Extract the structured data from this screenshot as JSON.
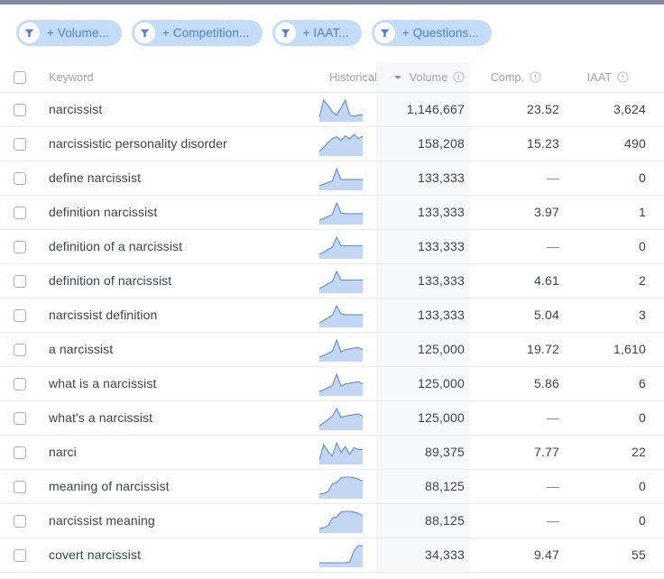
{
  "topbar": {
    "color": "#7e8a99"
  },
  "filters": {
    "chips": [
      {
        "label": "+ Volume...",
        "icon": "filter-funnel-icon"
      },
      {
        "label": "+ Competition...",
        "icon": "filter-funnel-icon"
      },
      {
        "label": "+ IAAT...",
        "icon": "filter-funnel-icon"
      },
      {
        "label": "+ Questions...",
        "icon": "filter-funnel-icon"
      }
    ]
  },
  "table": {
    "columns": {
      "keyword": "Keyword",
      "historical": "Historical",
      "volume": "Volume",
      "comp": "Comp.",
      "iaat": "IAAT"
    },
    "sorted_by": "Volume",
    "sort_direction": "desc",
    "rows": [
      {
        "keyword": "narcissist",
        "volume": "1,146,667",
        "comp": "23.52",
        "iaat": "3,624",
        "spark": [
          62,
          30,
          40,
          52,
          58,
          44,
          30,
          58,
          60,
          58,
          58
        ]
      },
      {
        "keyword": "narcissistic personality disorder",
        "volume": "158,208",
        "comp": "15.23",
        "iaat": "490",
        "spark": [
          86,
          70,
          50,
          34,
          28,
          42,
          24,
          36,
          18,
          34,
          26
        ]
      },
      {
        "keyword": "define narcissist",
        "volume": "133,333",
        "comp": "—",
        "iaat": "0",
        "spark": [
          66,
          62,
          58,
          54,
          22,
          50,
          50,
          50,
          50,
          50,
          50
        ]
      },
      {
        "keyword": "definition narcissist",
        "volume": "133,333",
        "comp": "3.97",
        "iaat": "1",
        "spark": [
          68,
          64,
          58,
          52,
          20,
          48,
          50,
          50,
          50,
          50,
          50
        ]
      },
      {
        "keyword": "definition of a narcissist",
        "volume": "133,333",
        "comp": "—",
        "iaat": "0",
        "spark": [
          70,
          64,
          56,
          50,
          22,
          46,
          46,
          46,
          46,
          46,
          46
        ]
      },
      {
        "keyword": "definition of narcissist",
        "volume": "133,333",
        "comp": "4.61",
        "iaat": "2",
        "spark": [
          70,
          64,
          56,
          50,
          22,
          46,
          46,
          46,
          46,
          46,
          46
        ]
      },
      {
        "keyword": "narcissist definition",
        "volume": "133,333",
        "comp": "5.04",
        "iaat": "3",
        "spark": [
          72,
          64,
          56,
          48,
          18,
          44,
          46,
          46,
          46,
          46,
          46
        ]
      },
      {
        "keyword": "a narcissist",
        "volume": "125,000",
        "comp": "19.72",
        "iaat": "1,610",
        "spark": [
          60,
          56,
          50,
          44,
          14,
          46,
          40,
          38,
          36,
          34,
          40
        ]
      },
      {
        "keyword": "what is a narcissist",
        "volume": "125,000",
        "comp": "5.86",
        "iaat": "6",
        "spark": [
          60,
          56,
          50,
          44,
          14,
          46,
          40,
          38,
          36,
          34,
          40
        ]
      },
      {
        "keyword": "what's a narcissist",
        "volume": "125,000",
        "comp": "—",
        "iaat": "0",
        "spark": [
          66,
          58,
          48,
          38,
          16,
          42,
          38,
          36,
          34,
          32,
          38
        ]
      },
      {
        "keyword": "narci",
        "volume": "89,375",
        "comp": "7.77",
        "iaat": "22",
        "spark": [
          62,
          30,
          44,
          54,
          26,
          46,
          34,
          50,
          36,
          40,
          40
        ]
      },
      {
        "keyword": "meaning of narcissist",
        "volume": "88,125",
        "comp": "—",
        "iaat": "0",
        "spark": [
          74,
          72,
          66,
          44,
          40,
          26,
          24,
          24,
          26,
          30,
          36
        ]
      },
      {
        "keyword": "narcissist meaning",
        "volume": "88,125",
        "comp": "—",
        "iaat": "0",
        "spark": [
          74,
          72,
          66,
          44,
          40,
          26,
          24,
          24,
          26,
          30,
          36
        ]
      },
      {
        "keyword": "covert narcissist",
        "volume": "34,333",
        "comp": "9.47",
        "iaat": "55",
        "spark": [
          74,
          74,
          74,
          74,
          74,
          74,
          74,
          72,
          40,
          26,
          26
        ]
      }
    ]
  },
  "colors": {
    "chip_bg": "#c5dbfa",
    "chip_text": "#4a7fd4",
    "spark_fill": "#c3d7f5",
    "spark_line": "#5b8dd9",
    "text": "#3b4350",
    "header_text": "#9ea3ab",
    "band": "#f7f8fa"
  }
}
